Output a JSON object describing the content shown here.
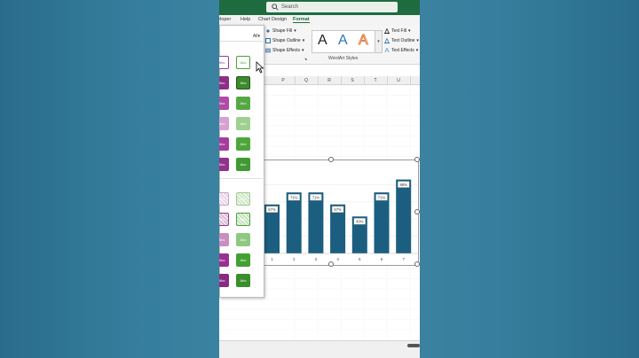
{
  "search": {
    "placeholder": "Search"
  },
  "tabs": [
    "eloper",
    "Help",
    "Chart Design",
    "Format"
  ],
  "ribbon": {
    "shape_fill": "Shape Fill",
    "shape_outline": "Shape Outline",
    "shape_effects": "Shape Effects",
    "wordart_glyph": "A",
    "wordart_group": "WordArt Styles",
    "text_fill": "Text Fill",
    "text_outline": "Text Outline",
    "text_effects": "Text Effects"
  },
  "columns": [
    "P",
    "Q",
    "R",
    "S",
    "T",
    "U"
  ],
  "panel": {
    "filter": "All",
    "swatch_text": "Abc"
  },
  "chart_data": {
    "type": "bar",
    "categories": [
      "1",
      "2",
      "3",
      "4",
      "5",
      "6",
      "7"
    ],
    "values": [
      57,
      71,
      71,
      57,
      43,
      71,
      86
    ],
    "data_labels": [
      "57%",
      "71%",
      "71%",
      "57%",
      "43%",
      "71%",
      "86%"
    ],
    "ylim": [
      0,
      100
    ],
    "bar_color": "#1b5e80"
  },
  "colors": {
    "ribbon_green": "#1d6b3f",
    "background": "#2f7697"
  }
}
